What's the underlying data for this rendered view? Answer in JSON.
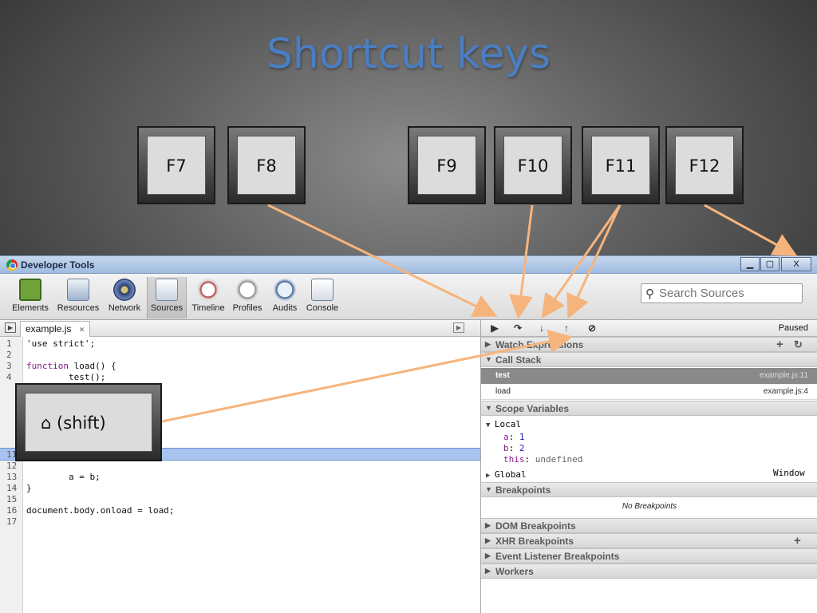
{
  "slide": {
    "title": "Shortcut keys",
    "keys": [
      "F7",
      "F8",
      "F9",
      "F10",
      "F11",
      "F12"
    ],
    "shift_key": "⌂ (shift)"
  },
  "window": {
    "title": "Developer Tools",
    "buttons": {
      "minimize": "▁",
      "maximize": "▢",
      "close": "X"
    }
  },
  "toolbar": {
    "items": [
      "Elements",
      "Resources",
      "Network",
      "Sources",
      "Timeline",
      "Profiles",
      "Audits",
      "Console"
    ],
    "active": "Sources"
  },
  "search": {
    "placeholder": "Search Sources"
  },
  "editor": {
    "file_tab": "example.js",
    "close_glyph": "✕",
    "lines": [
      {
        "n": "1",
        "text": "'use strict';"
      },
      {
        "n": "2",
        "text": ""
      },
      {
        "n": "3",
        "text": "function load() {"
      },
      {
        "n": "4",
        "text": "        test();"
      },
      {
        "n": "11",
        "text": ""
      },
      {
        "n": "12",
        "text": ""
      },
      {
        "n": "13",
        "text": "        a = b;"
      },
      {
        "n": "14",
        "text": "}"
      },
      {
        "n": "15",
        "text": ""
      },
      {
        "n": "16",
        "text": "document.body.onload = load;"
      },
      {
        "n": "17",
        "text": ""
      }
    ]
  },
  "debugger": {
    "paused_label": "Paused",
    "buttons": [
      "▶",
      "↷",
      "↓",
      "↑",
      "⊘"
    ],
    "sections": {
      "watch": "Watch Expressions",
      "call_stack": "Call Stack",
      "scope": "Scope Variables",
      "breakpoints": "Breakpoints",
      "dom": "DOM Breakpoints",
      "xhr": "XHR Breakpoints",
      "event": "Event Listener Breakpoints",
      "workers": "Workers"
    },
    "call_stack": [
      {
        "fn": "test",
        "loc": "example.js:11"
      },
      {
        "fn": "load",
        "loc": "example.js:4"
      }
    ],
    "scope": {
      "local_label": "Local",
      "vars": [
        {
          "name": "a",
          "value": "1"
        },
        {
          "name": "b",
          "value": "2"
        },
        {
          "name": "this",
          "value": "undefined"
        }
      ],
      "global_label": "Global",
      "global_value": "Window"
    },
    "no_breakpoints": "No Breakpoints"
  },
  "colors": {
    "accent": "#4a7ec4",
    "arrow": "#f6b47c",
    "highlight": "#a9c3f0"
  }
}
